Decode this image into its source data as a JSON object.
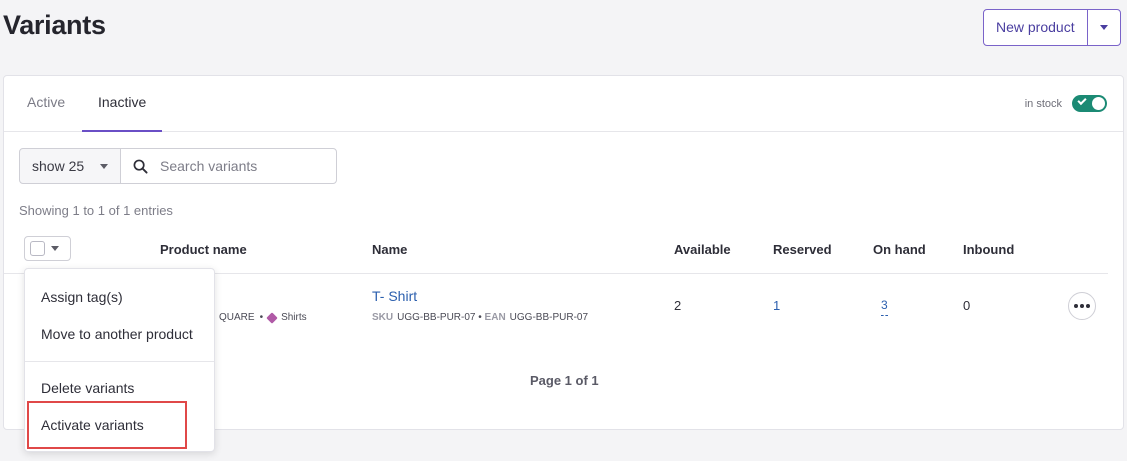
{
  "page": {
    "title": "Variants"
  },
  "header": {
    "new_product_label": "New product"
  },
  "tabs": [
    {
      "label": "Active",
      "active": false
    },
    {
      "label": "Inactive",
      "active": true
    }
  ],
  "filters": {
    "in_stock_label": "in stock",
    "in_stock_on": true
  },
  "toolbar": {
    "show_select_value": "show 25",
    "search_placeholder": "Search variants"
  },
  "entries_text": "Showing 1 to 1 of 1 entries",
  "table": {
    "columns": [
      "Product name",
      "Name",
      "Available",
      "Reserved",
      "On hand",
      "Inbound"
    ],
    "rows": [
      {
        "product_partial": "QUARE",
        "product_tag": "Shirts",
        "name": "T- Shirt",
        "sku_label": "SKU",
        "sku": "UGG-BB-PUR-07",
        "ean_label": "EAN",
        "ean": "UGG-BB-PUR-07",
        "available": "2",
        "reserved": "1",
        "on_hand": "3",
        "inbound": "0"
      }
    ]
  },
  "pagination": "Page 1 of 1",
  "bulk_menu": {
    "items": [
      "Assign tag(s)",
      "Move to another product",
      "Delete variants",
      "Activate variants"
    ]
  },
  "colors": {
    "accent": "#6a4fc6",
    "toggle": "#1b8a74",
    "link": "#2b5fae",
    "highlight": "#e04848"
  },
  "icons": [
    "caret-down-icon",
    "search-icon",
    "check-icon",
    "tag-icon",
    "more-icon"
  ]
}
